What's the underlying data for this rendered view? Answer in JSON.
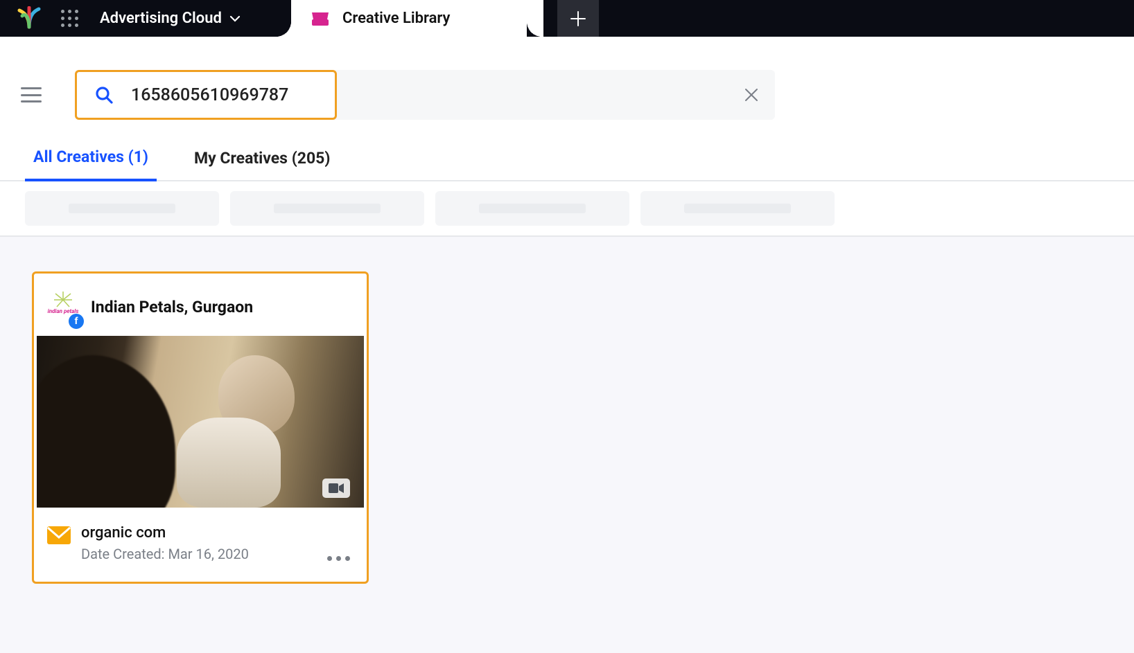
{
  "header": {
    "product_name": "Advertising Cloud",
    "tab_title": "Creative Library"
  },
  "search": {
    "query": "1658605610969787",
    "placeholder": ""
  },
  "view_tabs": {
    "all": {
      "label": "All Creatives",
      "count": 1
    },
    "my": {
      "label": "My Creatives",
      "count": 205
    },
    "all_display": "All Creatives (1)",
    "my_display": "My Creatives (205)"
  },
  "card": {
    "page_name": "Indian Petals, Gurgaon",
    "avatar_label": "indian petals",
    "platform": "facebook",
    "media_type": "video",
    "name": "organic com",
    "date_label": "Date Created:",
    "date_value": "Mar 16, 2020",
    "date_display": "Date Created:  Mar 16, 2020"
  },
  "colors": {
    "accent": "#1752ff",
    "highlight": "#f0a022"
  }
}
